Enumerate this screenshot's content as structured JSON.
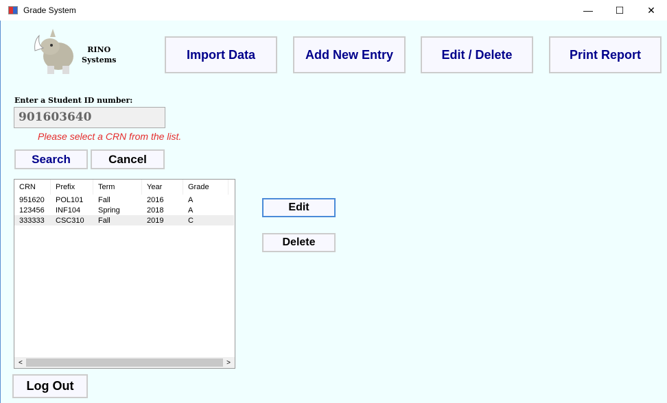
{
  "window": {
    "title": "Grade System",
    "minimize": "—",
    "maximize": "☐",
    "close": "✕"
  },
  "logo": {
    "line1": "RINO",
    "line2": "Systems"
  },
  "nav": {
    "import": "Import Data",
    "add": "Add New Entry",
    "edit_delete": "Edit / Delete",
    "print": "Print Report"
  },
  "search": {
    "label": "Enter a Student ID number:",
    "value": "901603640",
    "error": "Please select a CRN from the list.",
    "search_btn": "Search",
    "cancel_btn": "Cancel"
  },
  "table": {
    "headers": [
      "CRN",
      "Prefix",
      "Term",
      "Year",
      "Grade"
    ],
    "rows": [
      [
        "951620",
        "POL101",
        "Fall",
        "2016",
        "A"
      ],
      [
        "123456",
        "INF104",
        "Spring",
        "2018",
        "A"
      ],
      [
        "333333",
        "CSC310",
        "Fall",
        "2019",
        "C"
      ]
    ]
  },
  "actions": {
    "edit": "Edit",
    "delete": "Delete",
    "logout": "Log Out"
  },
  "scroll": {
    "left": "<",
    "right": ">"
  }
}
